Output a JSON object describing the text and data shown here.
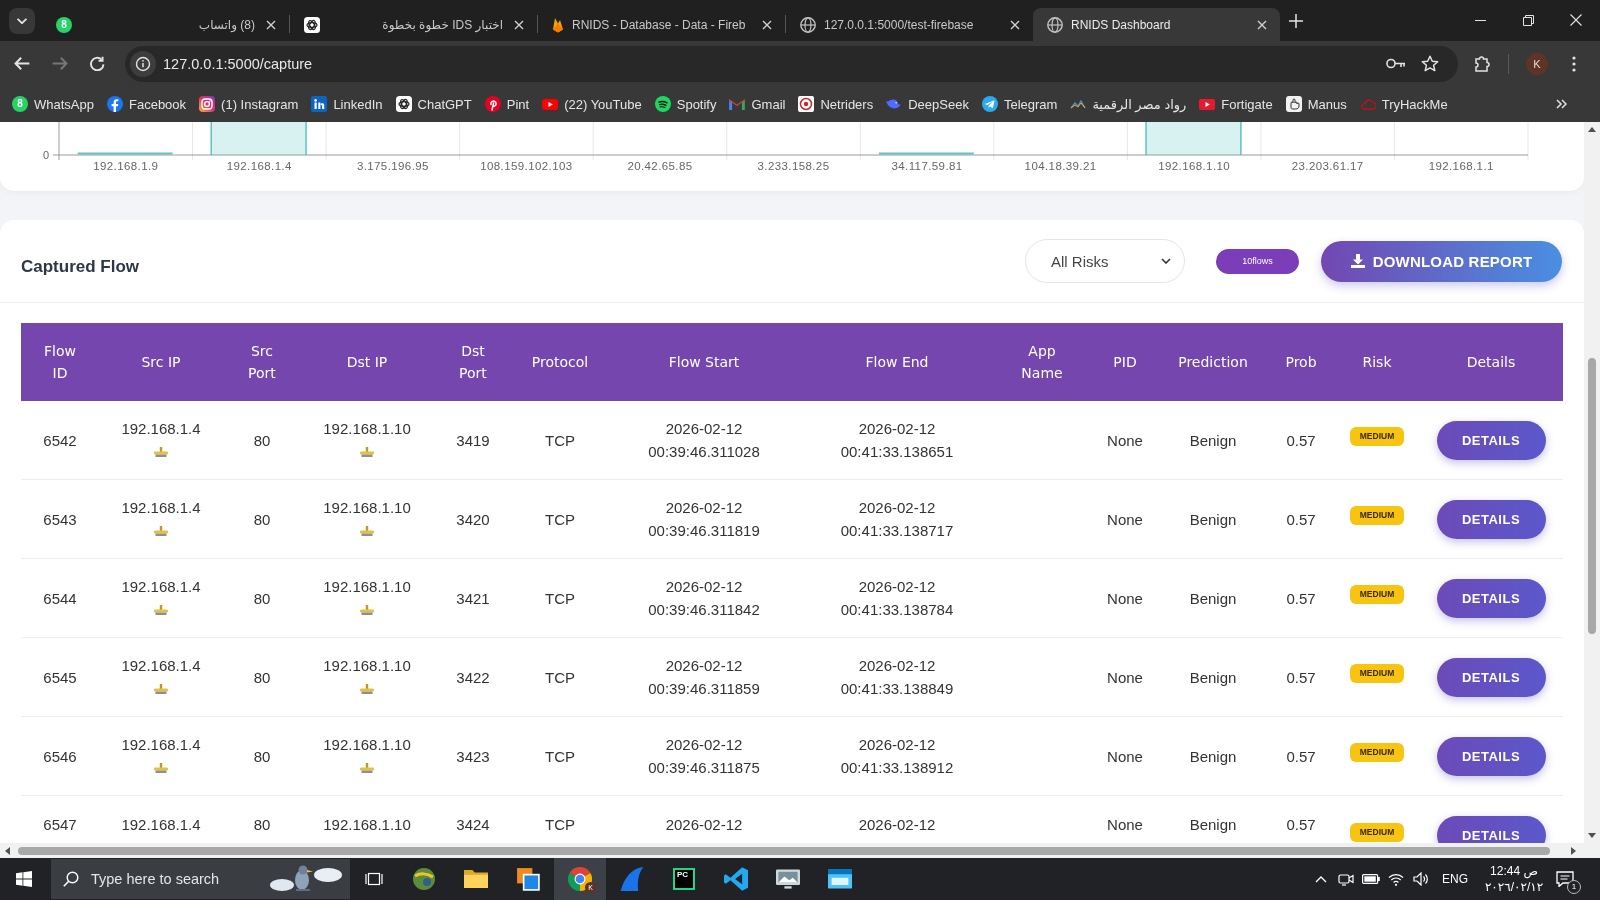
{
  "browser": {
    "tabs": [
      {
        "kind": "whatsapp",
        "badge": "8",
        "title": "(8) واتساب",
        "selected": false
      },
      {
        "kind": "chatgpt",
        "title": "اختبار IDS خطوة بخطوة",
        "selected": false
      },
      {
        "kind": "firebase",
        "title": "RNIDS - Database - Data - Fireb",
        "selected": false
      },
      {
        "kind": "globe",
        "title": "127.0.0.1:5000/test-firebase",
        "selected": false
      },
      {
        "kind": "globe",
        "title": "RNIDS Dashboard",
        "selected": true
      }
    ],
    "nav_buttons": [
      {
        "kind": "back",
        "disabled": false
      },
      {
        "kind": "forward",
        "disabled": true
      },
      {
        "kind": "reload",
        "disabled": false
      }
    ],
    "url": "127.0.0.1:5000/capture",
    "profile_initial": "K",
    "bookmarks": [
      {
        "kind": "whatsapp",
        "badge": "8",
        "label": "WhatsApp"
      },
      {
        "kind": "facebook",
        "label": "Facebook"
      },
      {
        "kind": "instagram",
        "label": "(1) Instagram"
      },
      {
        "kind": "linkedin",
        "label": "LinkedIn"
      },
      {
        "kind": "chatgpt",
        "label": "ChatGPT"
      },
      {
        "kind": "pinterest",
        "label": "Pint"
      },
      {
        "kind": "youtube",
        "label": "(22) YouTube"
      },
      {
        "kind": "spotify",
        "label": "Spotify"
      },
      {
        "kind": "gmail",
        "label": "Gmail"
      },
      {
        "kind": "netriders",
        "label": "Netriders"
      },
      {
        "kind": "deepseek",
        "label": "DeepSeek"
      },
      {
        "kind": "telegram",
        "label": "Telegram"
      },
      {
        "kind": "chart",
        "label": "رواد مصر الرقمية"
      },
      {
        "kind": "fortigate",
        "label": "Fortigate"
      },
      {
        "kind": "manus",
        "label": "Manus"
      },
      {
        "kind": "tryhackme",
        "label": "TryHackMe"
      }
    ]
  },
  "traffic_chart": {
    "y_tick": "0",
    "categories": [
      "192.168.1.9",
      "192.168.1.4",
      "3.175.196.95",
      "108.159.102.103",
      "20.42.65.85",
      "3.233.158.25",
      "34.117.59.81",
      "104.18.39.21",
      "192.168.1.10",
      "23.203.61.17",
      "192.168.1.1"
    ]
  },
  "captured_flow": {
    "title": "Captured Flow",
    "risk_filter": "All Risks",
    "flow_count": "10flows",
    "download_button": "DOWNLOAD REPORT",
    "columns": [
      "Flow ID",
      "Src IP",
      "Src Port",
      "Dst IP",
      "Dst Port",
      "Protocol",
      "Flow Start",
      "Flow End",
      "App Name",
      "PID",
      "Prediction",
      "Prob",
      "Risk",
      "Details"
    ],
    "rows": [
      {
        "kind": "full",
        "flow_id": "6542",
        "src_ip": "192.168.1.4",
        "src_port": "80",
        "dst_ip": "192.168.1.10",
        "dst_port": "3419",
        "protocol": "TCP",
        "flow_start": [
          "2026-02-12",
          "00:39:46.311028"
        ],
        "flow_end": [
          "2026-02-12",
          "00:41:33.138651"
        ],
        "pid": "None",
        "prediction": "Benign",
        "prob": "0.57",
        "risk": "MEDIUM",
        "details": "DETAILS"
      },
      {
        "kind": "full",
        "flow_id": "6543",
        "src_ip": "192.168.1.4",
        "src_port": "80",
        "dst_ip": "192.168.1.10",
        "dst_port": "3420",
        "protocol": "TCP",
        "flow_start": [
          "2026-02-12",
          "00:39:46.311819"
        ],
        "flow_end": [
          "2026-02-12",
          "00:41:33.138717"
        ],
        "pid": "None",
        "prediction": "Benign",
        "prob": "0.57",
        "risk": "MEDIUM",
        "details": "DETAILS"
      },
      {
        "kind": "full",
        "flow_id": "6544",
        "src_ip": "192.168.1.4",
        "src_port": "80",
        "dst_ip": "192.168.1.10",
        "dst_port": "3421",
        "protocol": "TCP",
        "flow_start": [
          "2026-02-12",
          "00:39:46.311842"
        ],
        "flow_end": [
          "2026-02-12",
          "00:41:33.138784"
        ],
        "pid": "None",
        "prediction": "Benign",
        "prob": "0.57",
        "risk": "MEDIUM",
        "details": "DETAILS"
      },
      {
        "kind": "full",
        "flow_id": "6545",
        "src_ip": "192.168.1.4",
        "src_port": "80",
        "dst_ip": "192.168.1.10",
        "dst_port": "3422",
        "protocol": "TCP",
        "flow_start": [
          "2026-02-12",
          "00:39:46.311859"
        ],
        "flow_end": [
          "2026-02-12",
          "00:41:33.138849"
        ],
        "pid": "None",
        "prediction": "Benign",
        "prob": "0.57",
        "risk": "MEDIUM",
        "details": "DETAILS"
      },
      {
        "kind": "full",
        "flow_id": "6546",
        "src_ip": "192.168.1.4",
        "src_port": "80",
        "dst_ip": "192.168.1.10",
        "dst_port": "3423",
        "protocol": "TCP",
        "flow_start": [
          "2026-02-12",
          "00:39:46.311875"
        ],
        "flow_end": [
          "2026-02-12",
          "00:41:33.138912"
        ],
        "pid": "None",
        "prediction": "Benign",
        "prob": "0.57",
        "risk": "MEDIUM",
        "details": "DETAILS"
      },
      {
        "kind": "cut",
        "flow_id": "6547",
        "src_ip": "192.168.1.4",
        "src_port": "80",
        "dst_ip": "192.168.1.10",
        "dst_port": "3424",
        "protocol": "TCP",
        "flow_start": [
          "2026-02-12"
        ],
        "flow_end": [
          "2026-02-12"
        ],
        "pid": "None",
        "prediction": "Benign",
        "prob": "0.57",
        "risk": "MEDIUM",
        "details": "DETAILS"
      }
    ]
  },
  "taskbar": {
    "search_placeholder": "Type here to search",
    "apps": [
      {
        "kind": "sphere",
        "selected": false
      },
      {
        "kind": "folder",
        "selected": false
      },
      {
        "kind": "squares",
        "selected": false
      },
      {
        "kind": "chrome",
        "badge": "K",
        "selected": true
      },
      {
        "kind": "fin",
        "selected": false
      },
      {
        "kind": "pycharm",
        "mark": "PC",
        "selected": false
      },
      {
        "kind": "code",
        "selected": false
      },
      {
        "kind": "monitor",
        "selected": false
      },
      {
        "kind": "window",
        "selected": false
      }
    ],
    "language": "ENG",
    "time": "12:44 ص",
    "date": "٢٠٢٦/٠٢/١٢",
    "notification_count": "1"
  }
}
